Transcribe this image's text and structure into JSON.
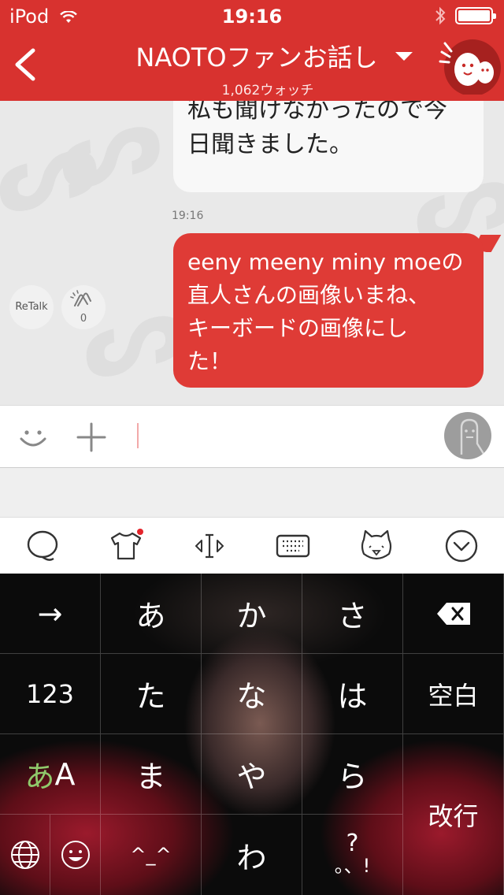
{
  "status_bar": {
    "carrier": "iPod",
    "time": "19:16"
  },
  "header": {
    "title": "NAOTOファンお話し",
    "subtitle": "1,062ウォッチ",
    "accent_color": "#d8322f",
    "back_icon": "chevron-left-icon",
    "mascot_icon": "mascot-icon"
  },
  "chat": {
    "incoming": {
      "lines": [
        "私も聞けなかったので今",
        "日聞きました。"
      ]
    },
    "timestamp": "19:16",
    "outgoing": {
      "lines": [
        "eeny meeny miny moeの",
        "直人さんの画像いまね、",
        "キーボードの画像にし",
        "た！"
      ]
    },
    "retalk_label": "ReTalk",
    "clap_count": "0"
  },
  "input_bar": {
    "emoji_icon": "smiley-icon",
    "add_icon": "plus-icon",
    "avatar_icon": "avatar-icon"
  },
  "keyboard_toolbar": {
    "icons": [
      "chat-bubble-icon",
      "tshirt-icon",
      "cursor-move-icon",
      "keyboard-icon",
      "cat-face-icon",
      "collapse-icon"
    ]
  },
  "keyboard": {
    "row1": [
      "→",
      "あ",
      "か",
      "さ"
    ],
    "row2": [
      "123",
      "た",
      "な",
      "は",
      "空白"
    ],
    "row3": {
      "mode_kana": "あ",
      "mode_alpha": "A",
      "keys": [
        "ま",
        "や",
        "ら"
      ]
    },
    "row4": [
      "^_^",
      "わ",
      "?"
    ],
    "row4_sub": "。、!",
    "enter": "改行"
  }
}
